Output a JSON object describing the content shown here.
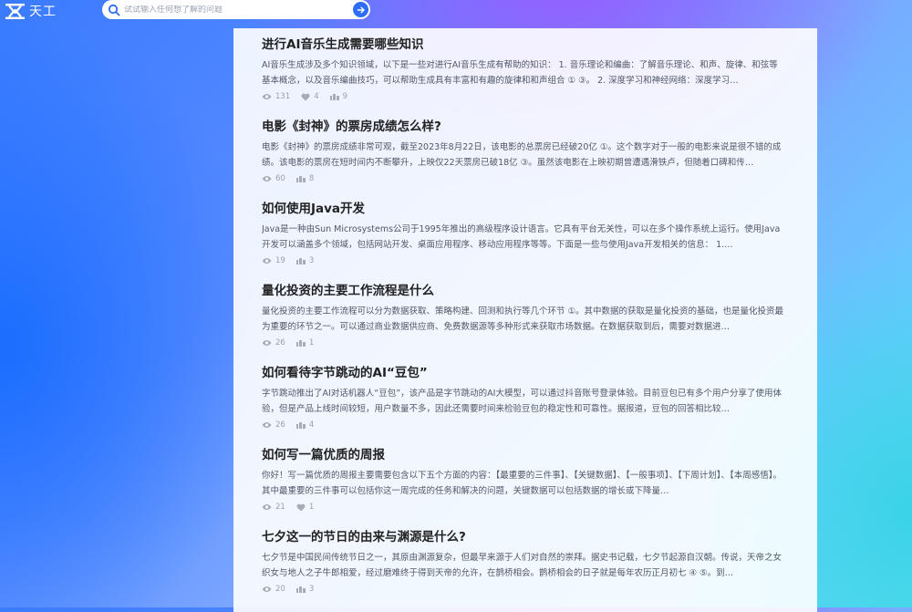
{
  "app": {
    "name": "天工"
  },
  "search": {
    "placeholder": "试试输入任何想了解的问题"
  },
  "items": [
    {
      "title": "进行AI音乐生成需要哪些知识",
      "summary": "AI音乐生成涉及多个知识领域，以下是一些对进行AI音乐生成有帮助的知识： 1. 音乐理论和编曲：了解音乐理论、和声、旋律、和弦等基本概念，以及音乐编曲技巧，可以帮助生成具有丰富和有趣的旋律和和声组合 ① ③。 2. 深度学习和神经网络：深度学习…",
      "views": "131",
      "likes": "4",
      "shares": "9"
    },
    {
      "title": "电影《封神》的票房成绩怎么样?",
      "summary": "电影《封神》的票房成绩非常可观，截至2023年8月22日，该电影的总票房已经破20亿 ①。这个数字对于一般的电影来说是很不错的成绩。该电影的票房在短时间内不断攀升，上映仅22天票房已破18亿 ③。虽然该电影在上映初期曾遭遇滑铁卢，但随着口碑和传…",
      "views": "60",
      "shares": "8"
    },
    {
      "title": "如何使用Java开发",
      "summary": "Java是一种由Sun Microsystems公司于1995年推出的高级程序设计语言。它具有平台无关性，可以在多个操作系统上运行。使用Java开发可以涵盖多个领域，包括网站开发、桌面应用程序、移动应用程序等等。下面是一些与使用Java开发相关的信息： 1.…",
      "views": "19",
      "shares": "3"
    },
    {
      "title": "量化投资的主要工作流程是什么",
      "summary": "量化投资的主要工作流程可以分为数据获取、策略构建、回测和执行等几个环节 ①。其中数据的获取是量化投资的基础，也是量化投资最为重要的环节之一。可以通过商业数据供应商、免费数据源等多种形式来获取市场数据。在数据获取到后，需要对数据进…",
      "views": "26",
      "shares": "1"
    },
    {
      "title": "如何看待字节跳动的AI“豆包”",
      "summary": "字节跳动推出了AI对话机器人“豆包”，该产品是字节跳动的AI大模型，可以通过抖音账号登录体验。目前豆包已有多个用户分享了使用体验，但是产品上线时间较短，用户数量不多，因此还需要时间来检验豆包的稳定性和可靠性。据报道，豆包的回答相比较…",
      "views": "26",
      "shares": "4"
    },
    {
      "title": "如何写一篇优质的周报",
      "summary": "你好！写一篇优质的周报主要需要包含以下五个方面的内容：【最重要的三件事】、【关键数据】、【一般事项】、【下周计划】、【本周感悟】。其中最重要的三件事可以包括你这一周完成的任务和解决的问题，关键数据可以包括数据的增长或下降量…",
      "views": "21",
      "likes": "1"
    },
    {
      "title": "七夕这一的节日的由来与渊源是什么?",
      "summary": "七夕节是中国民间传统节日之一，其原由渊源复杂，但最早来源于人们对自然的崇拜。据史书记载，七夕节起源自汉朝。传说，天帝之女织女与地人之子牛郎相爱，经过磨难终于得到天帝的允许，在鹊桥相会。鹊桥相会的日子就是每年农历正月初七 ④ ⑤。到…",
      "views": "20",
      "shares": "3"
    }
  ]
}
